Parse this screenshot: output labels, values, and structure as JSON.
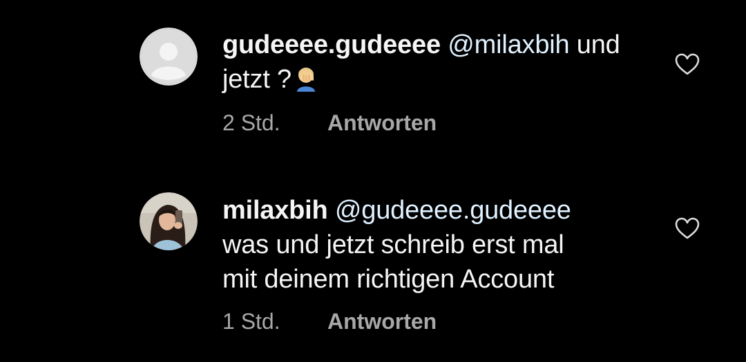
{
  "comments": [
    {
      "username": "gudeeee.gudeeee",
      "mention": "@milaxbih",
      "text_line1": "und",
      "text_line2": "jetzt ?",
      "emoji": "person-facepalming-icon",
      "time": "2 Std.",
      "reply_label": "Antworten",
      "avatar": "default-avatar-icon"
    },
    {
      "username": "milaxbih",
      "mention": "@gudeeee.gudeeee",
      "text_line1": "was und jetzt schreib erst mal",
      "text_line2": "mit deinem richtigen Account",
      "time": "1 Std.",
      "reply_label": "Antworten",
      "avatar": "profile-photo"
    }
  ],
  "colors": {
    "background": "#000000",
    "text": "#f5f5f5",
    "mention": "#e0f1ff",
    "secondary": "#a8a8a8"
  },
  "icons": {
    "like": "heart-outline-icon"
  }
}
